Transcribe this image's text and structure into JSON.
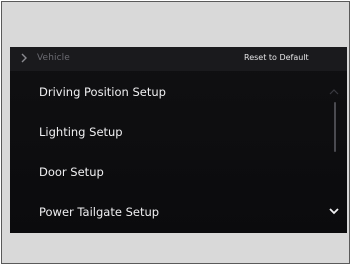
{
  "header": {
    "back_icon": "chevron-right-icon",
    "breadcrumb": "Vehicle",
    "reset_label": "Reset to Default"
  },
  "menu": {
    "items": [
      {
        "label": "Driving Position Setup"
      },
      {
        "label": "Lighting Setup"
      },
      {
        "label": "Door Setup"
      },
      {
        "label": "Power Tailgate Setup"
      }
    ]
  },
  "scroll": {
    "up_icon": "chevron-up-icon",
    "down_icon": "chevron-down-icon"
  },
  "colors": {
    "screen_bg": "#0c0c0e",
    "header_bg": "#1a1a1d",
    "text": "#f0f0f2",
    "breadcrumb_text": "#6b6b72"
  }
}
